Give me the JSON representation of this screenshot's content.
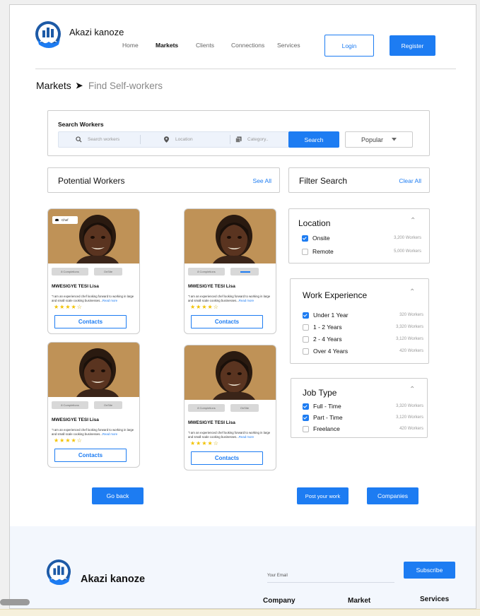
{
  "header": {
    "brand": "Akazi kanoze",
    "nav": [
      {
        "label": "Home",
        "active": false
      },
      {
        "label": "Markets",
        "active": true
      },
      {
        "label": "Clients",
        "active": false
      },
      {
        "label": "Connections",
        "active": false
      },
      {
        "label": "Services",
        "active": false
      }
    ],
    "login_label": "Login",
    "register_label": "Register"
  },
  "breadcrumb": {
    "root": "Markets",
    "current": "Find Self-workers"
  },
  "search": {
    "title": "Search Workers",
    "workers_placeholder": "Search workers",
    "location_placeholder": "Location",
    "category_placeholder": "Category..",
    "button_label": "Search",
    "sort_value": "Popular"
  },
  "workers_section": {
    "title": "Potential Workers",
    "see_all": "See All"
  },
  "filter_section": {
    "title": "Filter Search",
    "clear_all": "Clear All"
  },
  "workers": [
    {
      "badge": "Chef",
      "tag1": "8 Completions",
      "tag2": "OnSite",
      "name": "MWESIGYE TESI Lisa",
      "desc": "\"I am an experienced chef looking forward to working in large and small scale cooking businesses...",
      "more": "Read more",
      "rating": 4,
      "contacts": "Contacts"
    },
    {
      "badge": "",
      "tag1": "8 Completions",
      "tag2": "",
      "name": "MWESIGYE TESI Lisa",
      "desc": "\"I am an experienced chef looking forward to working in large and small scale cooking businesses...",
      "more": "Read more",
      "rating": 4,
      "contacts": "Contacts"
    },
    {
      "badge": "",
      "tag1": "8 Completions",
      "tag2": "OnSite",
      "name": "MWESIGYE TESI Lisa",
      "desc": "\"I am an experienced chef looking forward to working in large and small scale cooking businesses...",
      "more": "Read more",
      "rating": 4,
      "contacts": "Contacts"
    },
    {
      "badge": "",
      "tag1": "8 Completions",
      "tag2": "OnSite",
      "name": "MWESIGYE TESI Lisa",
      "desc": "\"I am an experienced chef looking forward to working in large and small scale cooking businesses...",
      "more": "Read more",
      "rating": 4,
      "contacts": "Contacts"
    }
  ],
  "filters": {
    "location": {
      "title": "Location",
      "options": [
        {
          "label": "Onsite",
          "count": "3,200 Workers",
          "checked": true
        },
        {
          "label": "Remote",
          "count": "5,000 Workers",
          "checked": false
        }
      ]
    },
    "experience": {
      "title": "Work Experience",
      "options": [
        {
          "label": "Under 1 Year",
          "count": "320 Workers",
          "checked": true
        },
        {
          "label": "1 - 2 Years",
          "count": "3,320 Workers",
          "checked": false
        },
        {
          "label": "2 - 4 Years",
          "count": "3,120 Workers",
          "checked": false
        },
        {
          "label": "Over 4 Years",
          "count": "420 Workers",
          "checked": false
        }
      ]
    },
    "job_type": {
      "title": "Job Type",
      "options": [
        {
          "label": "Full - Time",
          "count": "3,320 Workers",
          "checked": true
        },
        {
          "label": "Part - Time",
          "count": "3,120 Workers",
          "checked": true
        },
        {
          "label": "Freelance",
          "count": "420 Workers",
          "checked": false
        }
      ]
    }
  },
  "actions": {
    "go_back": "Go back",
    "post_work": "Post your work",
    "companies": "Companies"
  },
  "footer": {
    "brand": "Akazi kanoze",
    "email_placeholder": "Your Email",
    "subscribe": "Subscribe",
    "columns": [
      "Company",
      "Market",
      "Services"
    ]
  },
  "colors": {
    "accent": "#1d7cf2",
    "star": "#f2c200",
    "footer_bg": "#f3f7fd"
  }
}
